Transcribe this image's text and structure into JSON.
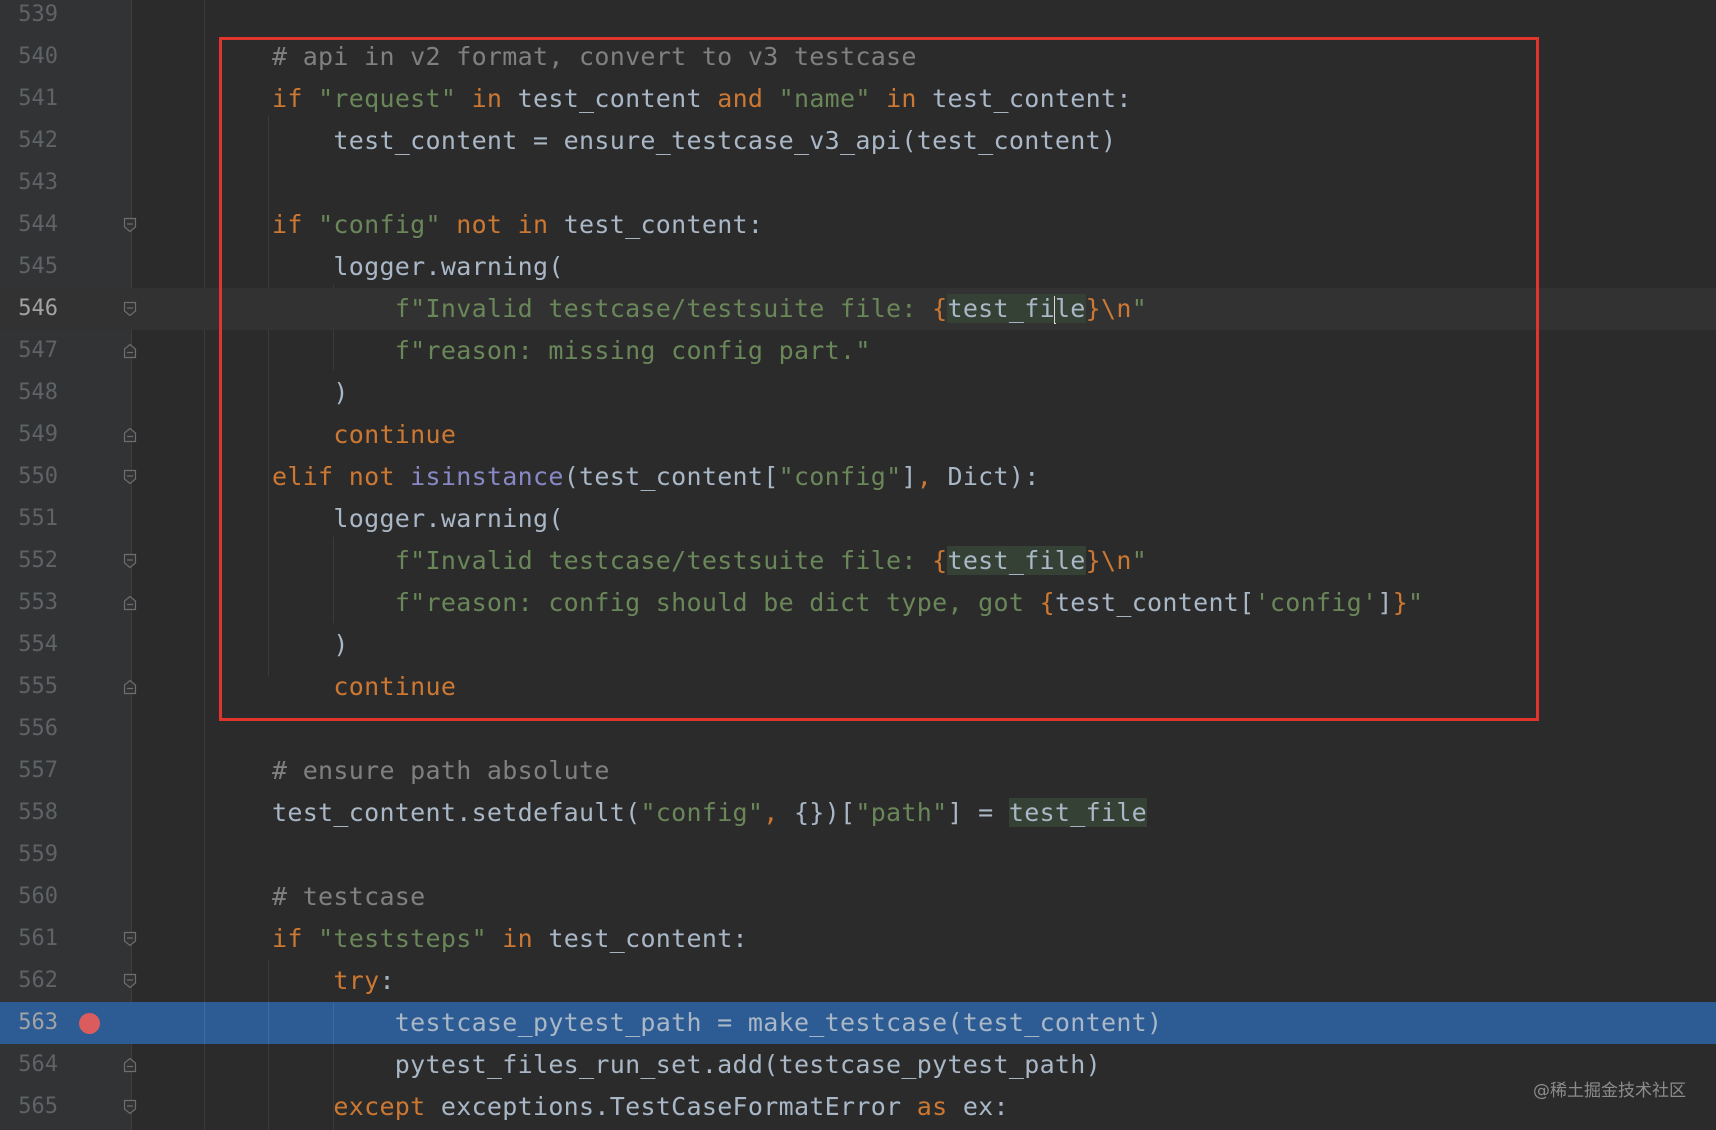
{
  "lines": [
    {
      "num": "539",
      "tokens": []
    },
    {
      "num": "540",
      "tokens": [
        {
          "t": "# api in v2 format, convert to v3 testcase",
          "c": "cm"
        }
      ]
    },
    {
      "num": "541",
      "tokens": [
        {
          "t": "if ",
          "c": "kw"
        },
        {
          "t": "\"request\"",
          "c": "str"
        },
        {
          "t": " in ",
          "c": "kw"
        },
        {
          "t": "test_content "
        },
        {
          "t": "and ",
          "c": "kw"
        },
        {
          "t": "\"name\"",
          "c": "str"
        },
        {
          "t": " in ",
          "c": "kw"
        },
        {
          "t": "test_content:"
        }
      ]
    },
    {
      "num": "542",
      "tokens": [
        {
          "t": "    test_content = ensure_testcase_v3_api(test_content)"
        }
      ]
    },
    {
      "num": "543",
      "tokens": []
    },
    {
      "num": "544",
      "tokens": [
        {
          "t": "if ",
          "c": "kw"
        },
        {
          "t": "\"config\"",
          "c": "str"
        },
        {
          "t": " not in ",
          "c": "kw"
        },
        {
          "t": "test_content:"
        }
      ]
    },
    {
      "num": "545",
      "tokens": [
        {
          "t": "    logger.warning("
        }
      ]
    },
    {
      "num": "546",
      "current": true,
      "tokens": [
        {
          "t": "        "
        },
        {
          "t": "f\"Invalid testcase/testsuite file: ",
          "c": "str"
        },
        {
          "t": "{",
          "c": "kw"
        },
        {
          "t": "test_fi",
          "hl": true
        },
        {
          "caret": true
        },
        {
          "t": "le",
          "hl": true
        },
        {
          "t": "}",
          "c": "kw"
        },
        {
          "t": "\\n",
          "c": "kw"
        },
        {
          "t": "\"",
          "c": "str"
        }
      ]
    },
    {
      "num": "547",
      "tokens": [
        {
          "t": "        "
        },
        {
          "t": "f\"reason: missing config part.\"",
          "c": "str"
        }
      ]
    },
    {
      "num": "548",
      "tokens": [
        {
          "t": "    )"
        }
      ]
    },
    {
      "num": "549",
      "tokens": [
        {
          "t": "    "
        },
        {
          "t": "continue",
          "c": "kw"
        }
      ]
    },
    {
      "num": "550",
      "tokens": [
        {
          "t": "elif not ",
          "c": "kw"
        },
        {
          "t": "isinstance",
          "c": "bi"
        },
        {
          "t": "(test_content["
        },
        {
          "t": "\"config\"",
          "c": "str"
        },
        {
          "t": "]"
        },
        {
          "t": ", ",
          "c": "kw"
        },
        {
          "t": "Dict):"
        }
      ]
    },
    {
      "num": "551",
      "tokens": [
        {
          "t": "    logger.warning("
        }
      ]
    },
    {
      "num": "552",
      "tokens": [
        {
          "t": "        "
        },
        {
          "t": "f\"Invalid testcase/testsuite file: ",
          "c": "str"
        },
        {
          "t": "{",
          "c": "kw"
        },
        {
          "t": "test_file",
          "hl": true
        },
        {
          "t": "}",
          "c": "kw"
        },
        {
          "t": "\\n",
          "c": "kw"
        },
        {
          "t": "\"",
          "c": "str"
        }
      ]
    },
    {
      "num": "553",
      "tokens": [
        {
          "t": "        "
        },
        {
          "t": "f\"reason: config should be dict type, got ",
          "c": "str"
        },
        {
          "t": "{",
          "c": "kw"
        },
        {
          "t": "test_content["
        },
        {
          "t": "'config'",
          "c": "str"
        },
        {
          "t": "]"
        },
        {
          "t": "}",
          "c": "kw"
        },
        {
          "t": "\"",
          "c": "str"
        }
      ]
    },
    {
      "num": "554",
      "tokens": [
        {
          "t": "    )"
        }
      ]
    },
    {
      "num": "555",
      "tokens": [
        {
          "t": "    "
        },
        {
          "t": "continue",
          "c": "kw"
        }
      ]
    },
    {
      "num": "556",
      "tokens": []
    },
    {
      "num": "557",
      "tokens": [
        {
          "t": "# ensure path absolute",
          "c": "cm"
        }
      ]
    },
    {
      "num": "558",
      "tokens": [
        {
          "t": "test_content.setdefault("
        },
        {
          "t": "\"config\"",
          "c": "str"
        },
        {
          "t": ", ",
          "c": "kw"
        },
        {
          "t": "{})["
        },
        {
          "t": "\"path\"",
          "c": "str"
        },
        {
          "t": "] = "
        },
        {
          "t": "test_file",
          "hl": true
        }
      ]
    },
    {
      "num": "559",
      "tokens": []
    },
    {
      "num": "560",
      "tokens": [
        {
          "t": "# testcase",
          "c": "cm"
        }
      ]
    },
    {
      "num": "561",
      "tokens": [
        {
          "t": "if ",
          "c": "kw"
        },
        {
          "t": "\"teststeps\"",
          "c": "str"
        },
        {
          "t": " in ",
          "c": "kw"
        },
        {
          "t": "test_content:"
        }
      ]
    },
    {
      "num": "562",
      "tokens": [
        {
          "t": "    "
        },
        {
          "t": "try",
          "c": "kw"
        },
        {
          "t": ":"
        }
      ]
    },
    {
      "num": "563",
      "exec": true,
      "breakpoint": true,
      "tokens": [
        {
          "t": "        testcase_pytest_path = make_testcase(test_content)"
        }
      ]
    },
    {
      "num": "564",
      "tokens": [
        {
          "t": "        pytest_files_run_set.add(testcase_pytest_path)"
        }
      ]
    },
    {
      "num": "565",
      "tokens": [
        {
          "t": "    "
        },
        {
          "t": "except ",
          "c": "kw"
        },
        {
          "t": "exceptions.TestCaseFormatError "
        },
        {
          "t": "as ",
          "c": "kw"
        },
        {
          "t": "ex:"
        }
      ]
    }
  ],
  "fold_markers": {
    "544": "open",
    "546": "open",
    "547": "close",
    "549": "close",
    "550": "open",
    "552": "open",
    "553": "close",
    "555": "close",
    "561": "open",
    "562": "open",
    "564": "close",
    "565": "open"
  },
  "colors": {
    "background": "#2b2b2b",
    "gutter": "#313335",
    "keyword": "#cc7832",
    "string": "#6a8759",
    "comment": "#808080",
    "builtin": "#8888c6",
    "identifier": "#a9b7c6",
    "execution_line": "#2d5c94",
    "breakpoint": "#db5c5c",
    "annotation_box": "#e0342d"
  },
  "watermark": "@稀土掘金技术社区"
}
